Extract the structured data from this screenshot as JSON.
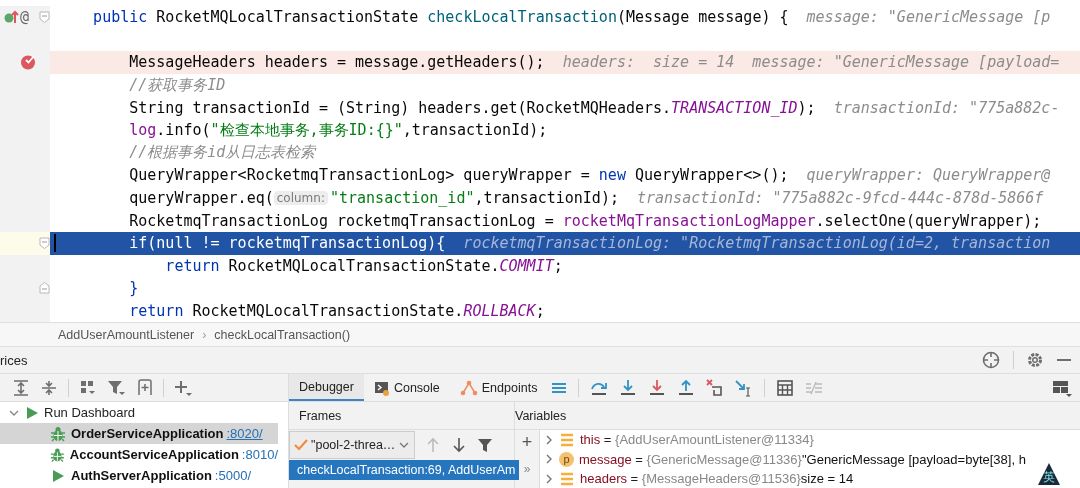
{
  "editor": {
    "lines": [
      {
        "kind": "method",
        "annotation": "@",
        "segments": [
          {
            "text": "public",
            "kind": "kw"
          },
          {
            "text": " RocketMQLocalTransactionState ",
            "kind": "plain"
          },
          {
            "text": "checkLocalTransaction",
            "kind": "fn"
          },
          {
            "text": "(Message message) {",
            "kind": "plain"
          },
          {
            "text": "message: \"GenericMessage [p",
            "kind": "hint"
          }
        ],
        "children": [
          {
            "kind": "blank"
          },
          {
            "kind": "breakpoint",
            "segments": [
              {
                "text": "MessageHeaders headers = message.getHeaders();",
                "kind": "plain"
              },
              {
                "text": "headers:  size = 14  message: \"GenericMessage [payload=",
                "kind": "hint"
              }
            ]
          },
          {
            "kind": "code",
            "segments": [
              {
                "text": "//获取事务ID",
                "kind": "comment"
              }
            ]
          },
          {
            "kind": "code",
            "segments": [
              {
                "text": "String transactionId = (String) headers.get(RocketMQHeaders.",
                "kind": "plain"
              },
              {
                "text": "TRANSACTION_ID",
                "kind": "const"
              },
              {
                "text": ");",
                "kind": "plain"
              },
              {
                "text": "transactionId: \"775a882c-",
                "kind": "hint"
              }
            ]
          },
          {
            "kind": "code",
            "segments": [
              {
                "text": "log",
                "kind": "field"
              },
              {
                "text": ".info(",
                "kind": "plain"
              },
              {
                "text": "\"检查本地事务,事务ID:{}\"",
                "kind": "str"
              },
              {
                "text": ",transactionId);",
                "kind": "plain"
              }
            ]
          },
          {
            "kind": "code",
            "segments": [
              {
                "text": "//根据事务id从日志表检索",
                "kind": "comment"
              }
            ]
          },
          {
            "kind": "code",
            "segments": [
              {
                "text": "QueryWrapper<RocketmqTransactionLog> queryWrapper = ",
                "kind": "plain"
              },
              {
                "text": "new",
                "kind": "kw"
              },
              {
                "text": " QueryWrapper<>();",
                "kind": "plain"
              },
              {
                "text": "queryWrapper: QueryWrapper@",
                "kind": "hint"
              }
            ]
          },
          {
            "kind": "code",
            "segments": [
              {
                "text": "queryWrapper.eq(",
                "kind": "plain"
              },
              {
                "text": "column:",
                "kind": "param"
              },
              {
                "text": "\"transaction_id\"",
                "kind": "str"
              },
              {
                "text": ",transactionId);",
                "kind": "plain"
              },
              {
                "text": "transactionId: \"775a882c-9fcd-444c-878d-5866f",
                "kind": "hint"
              }
            ]
          },
          {
            "kind": "code",
            "segments": [
              {
                "text": "RocketmqTransactionLog rocketmqTransactionLog = ",
                "kind": "plain"
              },
              {
                "text": "rocketMqTransactionLogMapper",
                "kind": "field"
              },
              {
                "text": ".selectOne(queryWrapper);",
                "kind": "plain"
              }
            ]
          },
          {
            "kind": "execution",
            "segments": [
              {
                "text": "if(null != rocketmqTransactionLog){",
                "kind": "plain"
              },
              {
                "text": "rocketmqTransactionLog: \"RocketmqTransactionLog(id=2, transaction",
                "kind": "hint"
              }
            ],
            "children": [
              {
                "kind": "code",
                "segments": [
                  {
                    "text": "return",
                    "kind": "kw"
                  },
                  {
                    "text": " RocketMQLocalTransactionState.",
                    "kind": "plain"
                  },
                  {
                    "text": "COMMIT",
                    "kind": "const"
                  },
                  {
                    "text": ";",
                    "kind": "plain"
                  }
                ]
              }
            ]
          },
          {
            "kind": "close",
            "segments": [
              {
                "text": "}",
                "kind": "kw"
              }
            ]
          },
          {
            "kind": "code",
            "segments": [
              {
                "text": "return",
                "kind": "kw"
              },
              {
                "text": " RocketMQLocalTransactionState.",
                "kind": "plain"
              },
              {
                "text": "ROLLBACK",
                "kind": "const"
              },
              {
                "text": ";",
                "kind": "plain"
              }
            ]
          }
        ]
      }
    ]
  },
  "breadcrumb": {
    "items": [
      "AddUserAmountListener",
      "checkLocalTransaction()"
    ],
    "separator": "›"
  },
  "services": {
    "title": "rices",
    "tree": {
      "label": "Run Dashboard",
      "expanded": true,
      "children": [
        {
          "name": "OrderServiceApplication",
          "port": ":8020/",
          "kind": "debug",
          "selected": true
        },
        {
          "name": "AccountServiceApplication",
          "port": ":8010/",
          "kind": "debug",
          "selected": false
        },
        {
          "name": "AuthServerApplication",
          "port": ":5000/",
          "kind": "run",
          "selected": false
        }
      ]
    },
    "tabs": [
      {
        "label": "Debugger",
        "kind": "debugger",
        "selected": true
      },
      {
        "label": "Console",
        "kind": "console",
        "selected": false
      },
      {
        "label": "Endpoints",
        "kind": "endpoints",
        "selected": false
      }
    ],
    "frames": {
      "title": "Frames",
      "thread": "\"pool-2-threa…",
      "items": [
        {
          "label": "checkLocalTransaction:69, AddUserAm",
          "selected": true
        }
      ],
      "more": "»"
    },
    "variables": {
      "title": "Variables",
      "add": "+",
      "rows": [
        {
          "kind": "field",
          "name": "this",
          "equals": "=",
          "value": "{AddUserAmountListener@11334}"
        },
        {
          "kind": "param",
          "badge": "p",
          "name": "message",
          "equals": "=",
          "value": "{GenericMessage@11336}",
          "extra": "\"GenericMessage [payload=byte[38], h"
        },
        {
          "kind": "field",
          "name": "headers",
          "equals": "=",
          "value": "{MessageHeaders@11536}",
          "extra": "size = 14"
        }
      ]
    }
  },
  "ime_indicator": "英"
}
